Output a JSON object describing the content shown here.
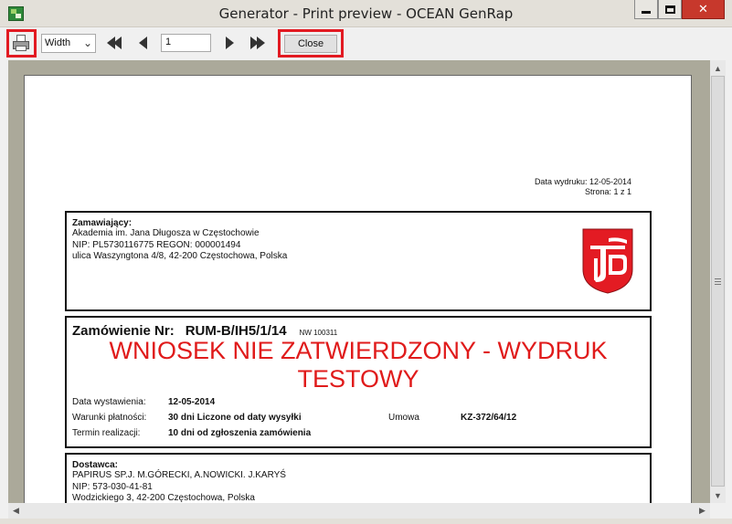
{
  "window": {
    "title": "Generator  - Print preview - OCEAN GenRap",
    "close_glyph": "✕"
  },
  "toolbar": {
    "zoom_value": "Width",
    "page_value": "1",
    "close_label": "Close"
  },
  "document": {
    "print_date": "Data wydruku: 12-05-2014",
    "page_info": "Strona: 1 z 1",
    "orderer": {
      "heading": "Zamawiający:",
      "line1": "Akademia im. Jana Długosza w Częstochowie",
      "line2": "NIP: PL5730116775   REGON: 000001494",
      "line3": "ulica Waszyngtona 4/8, 42-200 Częstochowa, Polska"
    },
    "order": {
      "label": "Zamówienie Nr:",
      "number": "RUM-B/IH5/1/14",
      "nw": "NW 100311",
      "warning_line1": "WNIOSEK NIE ZATWIERDZONY - WYDRUK",
      "warning_line2": "TESTOWY",
      "issue_date_label": "Data wystawienia:",
      "issue_date_value": "12-05-2014",
      "payment_label": "Warunki płatności:",
      "payment_value": "30 dni Liczone od daty wysyłki",
      "contract_label": "Umowa",
      "contract_value": "KZ-372/64/12",
      "deadline_label": "Termin realizacji:",
      "deadline_value": "10 dni od zgłoszenia zamówienia"
    },
    "supplier": {
      "heading": "Dostawca:",
      "line1": "PAPIRUS SP.J. M.GÓRECKI, A.NOWICKI. J.KARYŚ",
      "line2": "NIP: 573-030-41-81",
      "line3": "Wodzickiego 3, 42-200 Częstochowa, Polska"
    },
    "crest_colors": {
      "shield": "#e31b23",
      "emblem": "#ffffff"
    }
  },
  "colors": {
    "highlight": "#e21a22",
    "warning_text": "#e01b1b",
    "preview_bg": "#aba99a"
  }
}
